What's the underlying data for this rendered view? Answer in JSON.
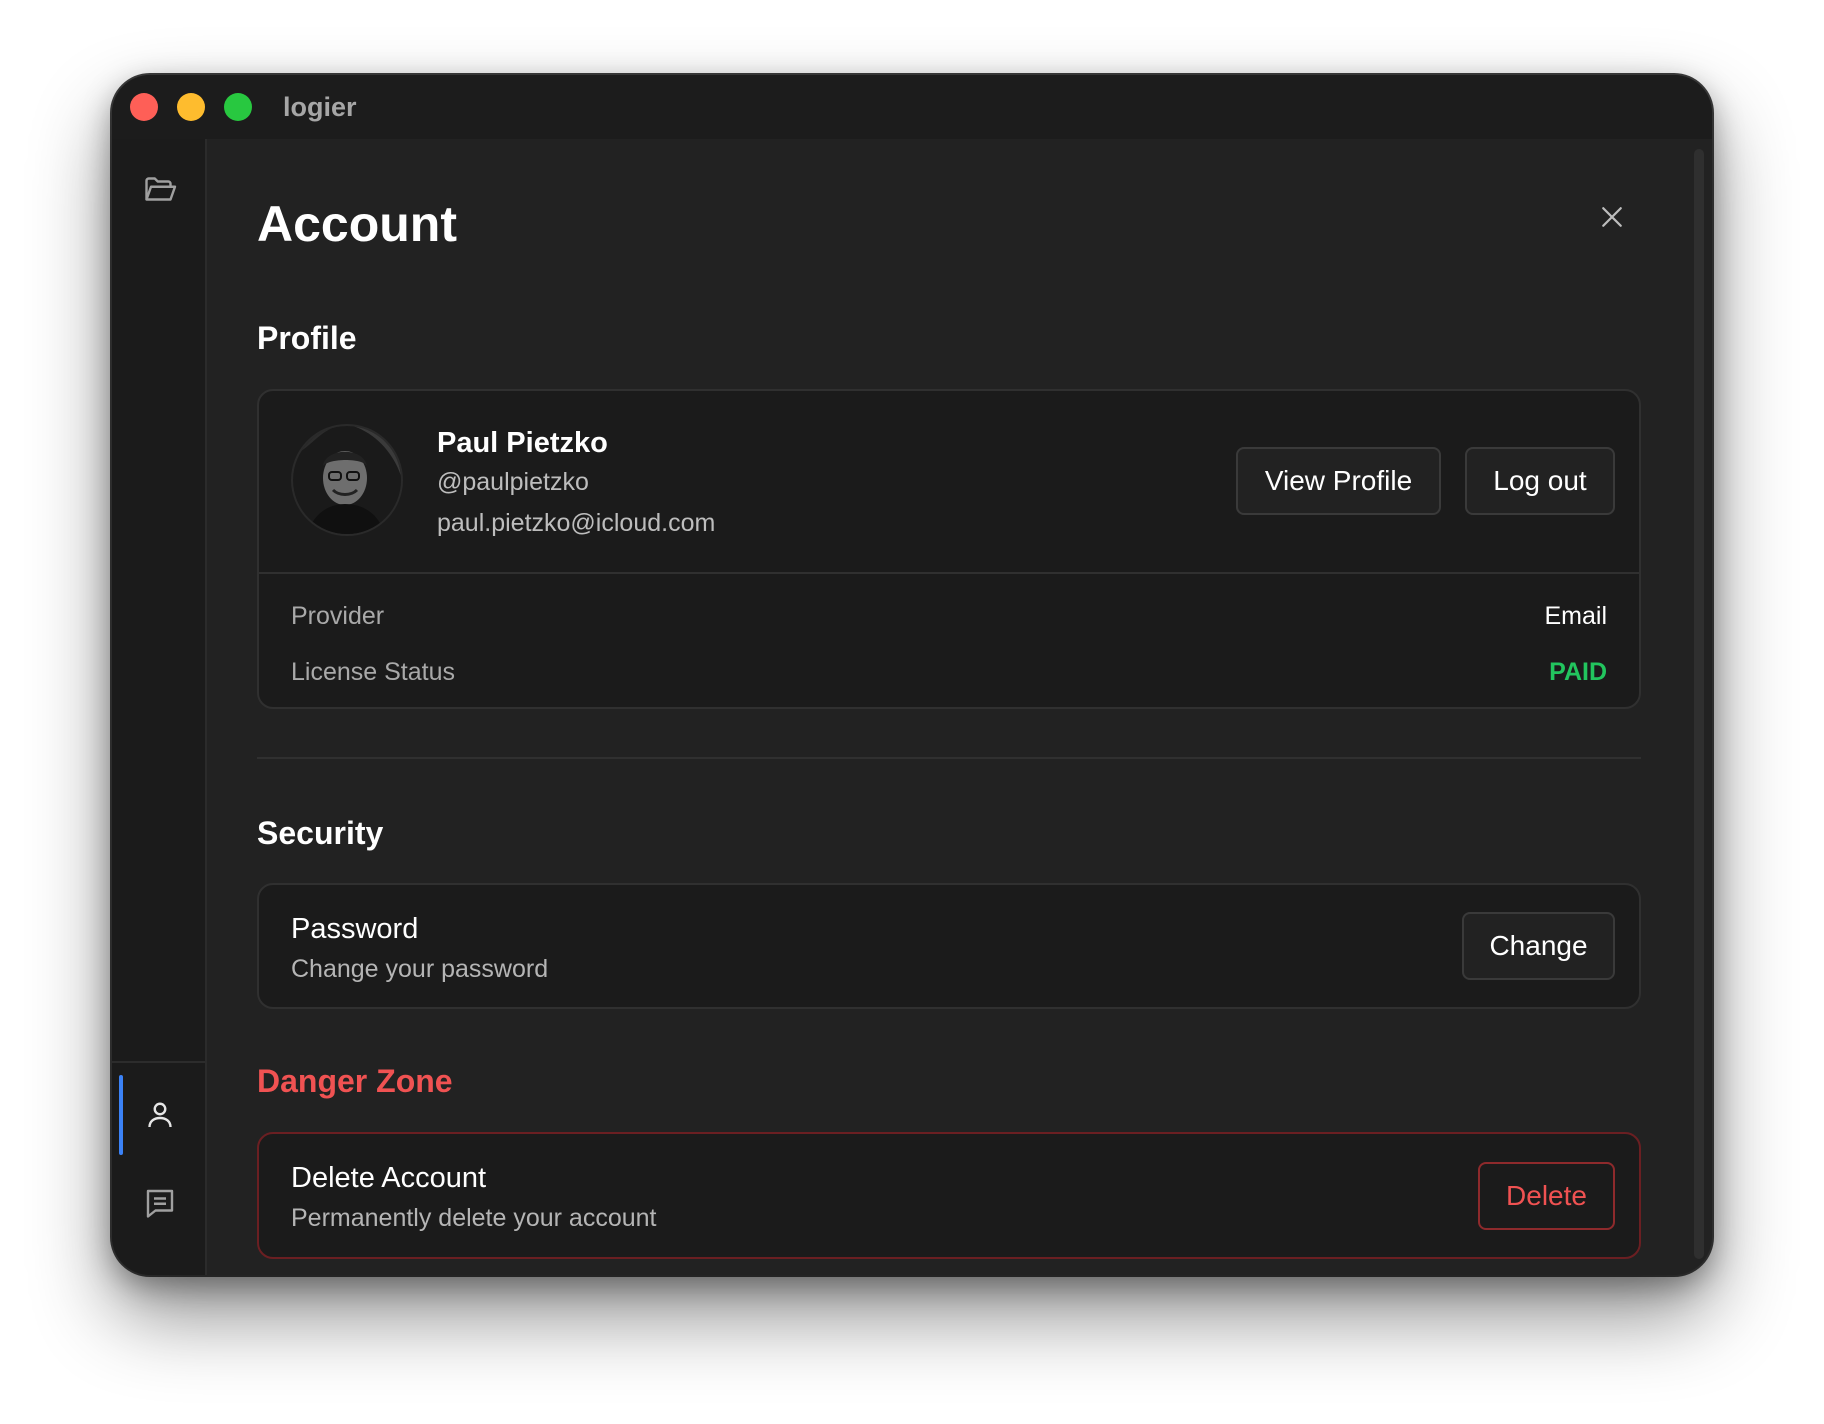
{
  "window": {
    "app_title": "logier"
  },
  "sidebar": {
    "top_items": [
      {
        "icon": "folder-open-icon"
      }
    ],
    "bottom_items": [
      {
        "icon": "user-icon",
        "active": true
      },
      {
        "icon": "message-icon",
        "active": false
      },
      {
        "icon": "gear-icon",
        "active": false
      }
    ]
  },
  "page": {
    "title": "Account",
    "close_icon": "close-icon"
  },
  "profile": {
    "section_title": "Profile",
    "name": "Paul Pietzko",
    "handle": "@paulpietzko",
    "email": "paul.pietzko@icloud.com",
    "view_profile_label": "View Profile",
    "logout_label": "Log out",
    "rows": [
      {
        "label": "Provider",
        "value": "Email"
      },
      {
        "label": "License Status",
        "value": "PAID"
      }
    ]
  },
  "security": {
    "section_title": "Security",
    "password_title": "Password",
    "password_subtitle": "Change your password",
    "change_label": "Change"
  },
  "danger": {
    "section_title": "Danger Zone",
    "delete_title": "Delete Account",
    "delete_subtitle": "Permanently delete your account",
    "delete_label": "Delete"
  },
  "colors": {
    "accent": "#3b82f6",
    "danger": "#f05252",
    "success": "#22c55e"
  }
}
